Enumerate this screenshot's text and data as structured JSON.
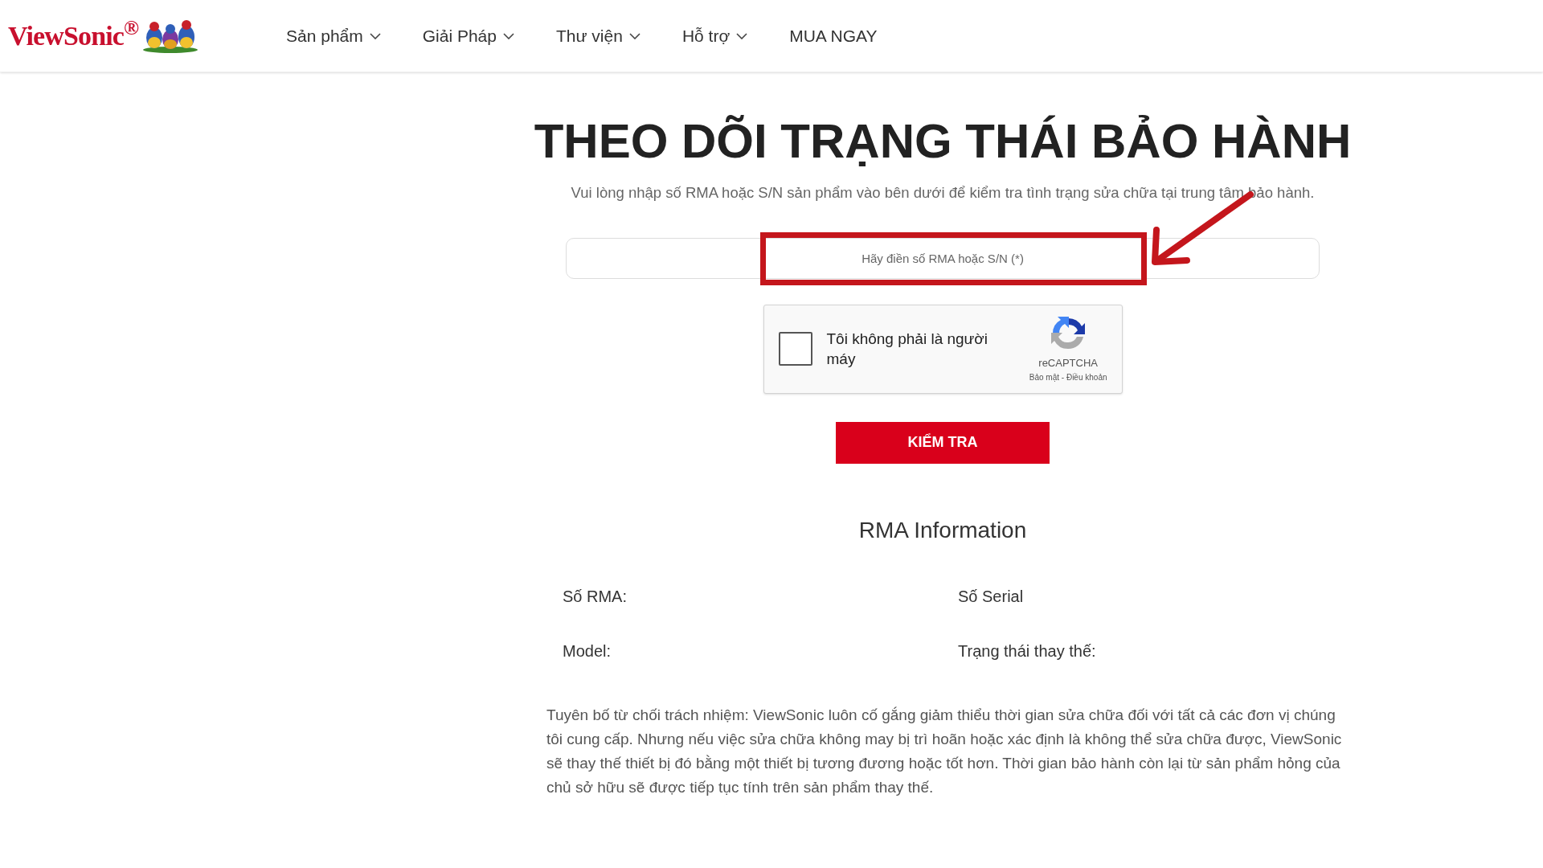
{
  "header": {
    "brand": "ViewSonic$^{®}$",
    "nav": [
      {
        "label": "Sản phẩm",
        "kind": "dropdown"
      },
      {
        "label": "Giải Pháp",
        "kind": "dropdown"
      },
      {
        "label": "Thư viện",
        "kind": "dropdown"
      },
      {
        "label": "Hỗ trợ",
        "kind": "dropdown"
      },
      {
        "label": "MUA NGAY",
        "kind": "link"
      }
    ]
  },
  "title": "THEO DÕI TRẠNG THÁI BẢO HÀNH",
  "subtitle": "Vui lòng nhập số RMA hoặc S/N sản phẩm vào bên dưới để kiểm tra tình trạng sửa chữa tại trung tâm bảo hành.",
  "search": {
    "placeholder": "Hãy điền số RMA hoặc S/N (*)"
  },
  "captcha": {
    "label": "Tôi không phải là người máy",
    "checked": false,
    "brand": "reCAPTCHA",
    "links": "Bảo mật - Điều khoản"
  },
  "submit": "KIỂM TRA",
  "rma": {
    "heading": "RMA Information",
    "fields": [
      {
        "label": "Số RMA:"
      },
      {
        "label": "Số Serial"
      },
      {
        "label": "Model:"
      },
      {
        "label": "Trạng thái thay thế:"
      }
    ]
  },
  "disclaimer": "Tuyên bố từ chối trách nhiệm: ViewSonic luôn cố gắng giảm thiểu thời gian sửa chữa đối với tất cả các đơn vị chúng tôi cung cấp. Nhưng nếu việc sửa chữa không may bị trì hoãn hoặc xác định là không thể sửa chữa được, ViewSonic sẽ thay thế thiết bị đó bằng một thiết bị tương đương hoặc tốt hơn. Thời gian bảo hành còn lại từ sản phẩm hỏng của chủ sở hữu sẽ được tiếp tục tính trên sản phẩm thay thế."
}
